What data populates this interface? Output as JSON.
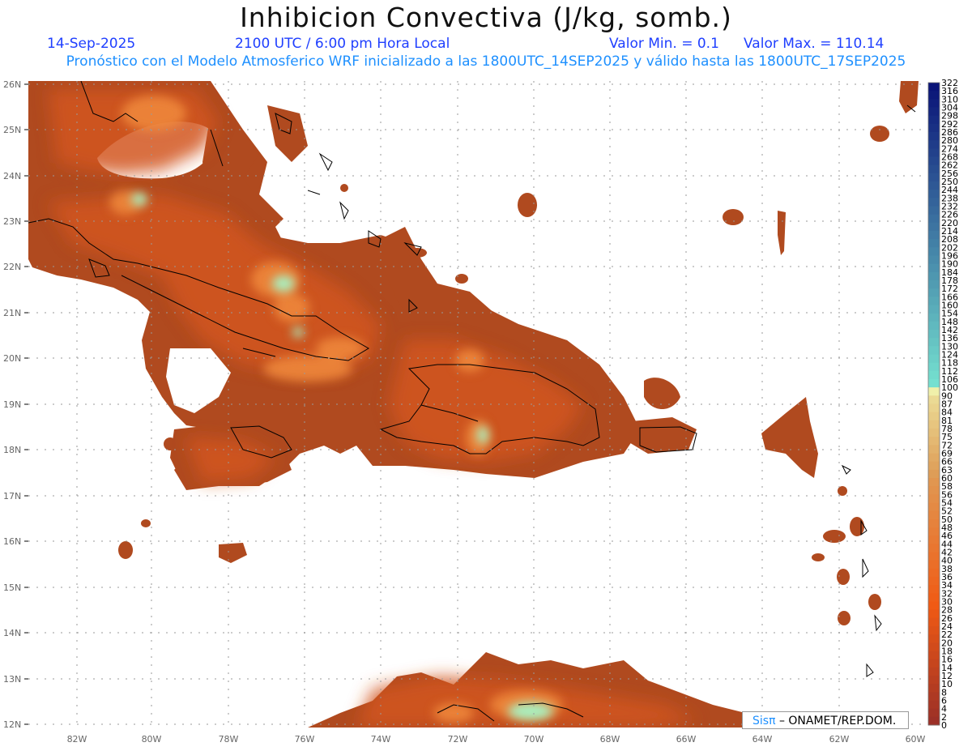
{
  "header": {
    "title": "Inhibicion Convectiva (J/kg, somb.)",
    "date": "14-Sep-2025",
    "time": "2100 UTC / 6:00 pm Hora Local",
    "min": "Valor Min. = 0.1",
    "max": "Valor Max. = 110.14",
    "model_line": "Pronóstico con el Modelo Atmosferico WRF inicializado a las 1800UTC_14SEP2025 y válido hasta las  1800UTC_17SEP2025"
  },
  "axes": {
    "lon_labels": [
      "82W",
      "80W",
      "78W",
      "76W",
      "74W",
      "72W",
      "70W",
      "68W",
      "66W",
      "64W",
      "62W",
      "60W"
    ],
    "lat_labels": [
      "26N",
      "25N",
      "24N",
      "23N",
      "22N",
      "21N",
      "20N",
      "19N",
      "18N",
      "17N",
      "16N",
      "15N",
      "14N",
      "13N",
      "12N"
    ]
  },
  "colorbar": {
    "labels": [
      "322",
      "316",
      "310",
      "304",
      "298",
      "292",
      "286",
      "280",
      "274",
      "268",
      "262",
      "256",
      "250",
      "244",
      "238",
      "232",
      "226",
      "220",
      "214",
      "208",
      "202",
      "196",
      "190",
      "184",
      "178",
      "172",
      "166",
      "160",
      "154",
      "148",
      "142",
      "136",
      "130",
      "124",
      "118",
      "112",
      "106",
      "100",
      "90",
      "87",
      "84",
      "81",
      "78",
      "75",
      "72",
      "69",
      "66",
      "63",
      "60",
      "58",
      "56",
      "54",
      "52",
      "50",
      "48",
      "46",
      "44",
      "42",
      "40",
      "38",
      "36",
      "34",
      "32",
      "30",
      "28",
      "26",
      "24",
      "22",
      "20",
      "18",
      "16",
      "14",
      "12",
      "10",
      "8",
      "6",
      "4",
      "2",
      "0"
    ]
  },
  "colors": {
    "field_base": "#b04a1f",
    "field_mid": "#d2561c",
    "field_high": "#f08a3c",
    "field_peak": "#a8f0c0",
    "coast": "#000000",
    "grid": "#9a9a9a"
  },
  "credit": {
    "brand": "Sisπ",
    "text": " – ONAMET/REP.DOM."
  }
}
